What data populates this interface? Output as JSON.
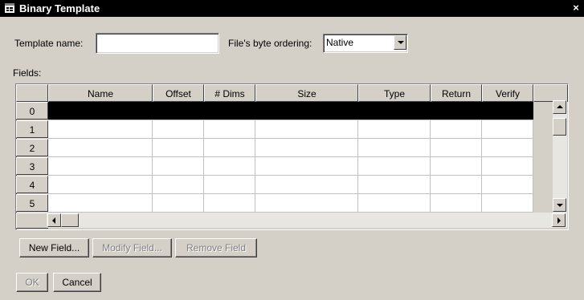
{
  "window": {
    "title": "Binary Template",
    "close_glyph": "×"
  },
  "form": {
    "template_name_label": "Template name:",
    "template_name_value": "",
    "byte_order_label": "File's byte ordering:",
    "byte_order_value": "Native"
  },
  "fields": {
    "label": "Fields:",
    "columns": [
      "Name",
      "Offset",
      "# Dims",
      "Size",
      "Type",
      "Return",
      "Verify"
    ],
    "row_numbers": [
      "0",
      "1",
      "2",
      "3",
      "4",
      "5"
    ],
    "selected_row": 0
  },
  "field_buttons": {
    "new": "New Field...",
    "modify": "Modify Field...",
    "remove": "Remove Field"
  },
  "dialog_buttons": {
    "ok": "OK",
    "cancel": "Cancel"
  },
  "colors": {
    "face": "#d4d0c8",
    "selection": "#000000",
    "title_bar": "#000000"
  }
}
